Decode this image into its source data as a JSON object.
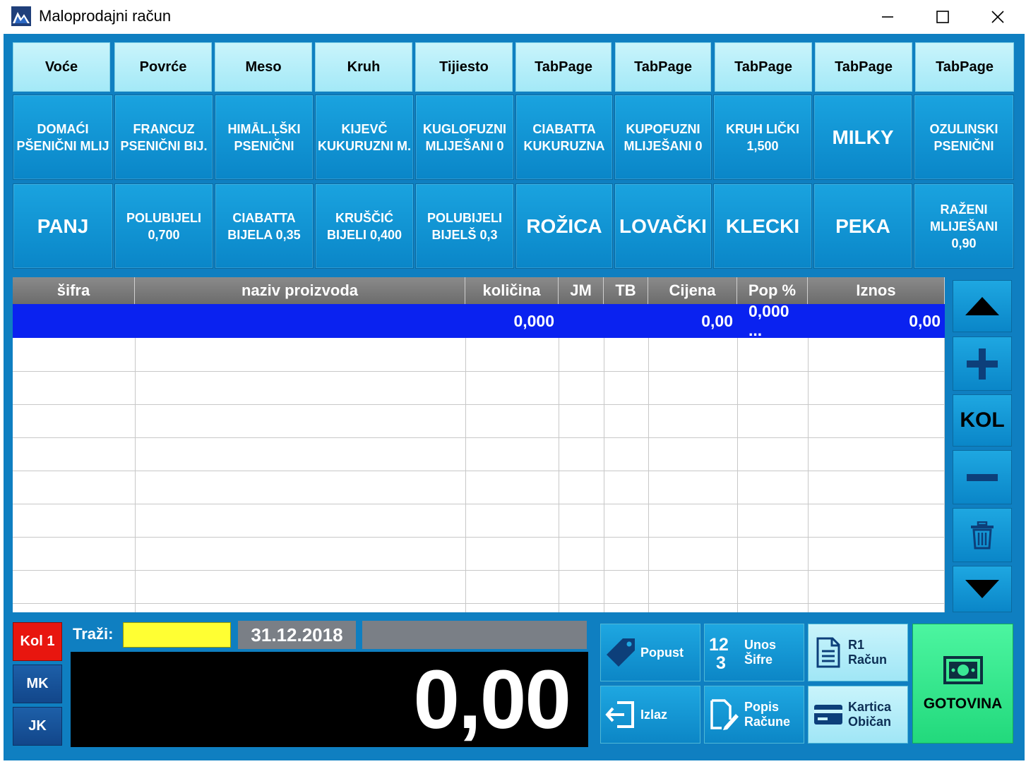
{
  "window": {
    "title": "Maloprodajni račun"
  },
  "colors": {
    "accent": "#0f7fc1",
    "selected_row": "#0a22f0",
    "kol_active": "#e8160f",
    "cash_green": "#22d97c",
    "search_bg": "#ffff33"
  },
  "tabs": [
    "Voće",
    "Povrće",
    "Meso",
    "Kruh",
    "Tijiesto",
    "TabPage",
    "TabPage",
    "TabPage",
    "TabPage",
    "TabPage"
  ],
  "products": [
    [
      "DOMAĆI\nPŠENIČNI MLIJ",
      "FRANCUZ\nPSENIČNI BIJ.",
      "HIMĀL.ĻŠKI\nPSENIČNI",
      "KIJEVČ\nKUKURUZNI M.",
      "KUGLOFUZNI\nMLIJEŠANI 0",
      "CIABATTA\nKUKURUZNA",
      "KUPOFUZNI\nMLIJEŠANI 0",
      "KRUH LIČKI\n1,500",
      "MILKY",
      "OZULINSKI\nPSENIČNI"
    ],
    [
      "PANJ",
      "POLUBIJELI\n0,700",
      "CIABATTA\nBIJELA 0,35",
      "KRUŠČIĆ\nBIJELI 0,400",
      "POLUBIJELI\nBIJELŠ 0,3",
      "ROŽICA",
      "LOVAČKI",
      "KLECKI",
      "PEKA",
      "RAŽENI\nMLIJEŠANI 0,90"
    ]
  ],
  "grid": {
    "columns": [
      "šifra",
      "naziv proizvoda",
      "količina",
      "JM",
      "TB",
      "Cijena",
      "Pop %",
      "Iznos"
    ],
    "selected_row": {
      "sifra": "",
      "naziv": "",
      "kolicina": "0,000",
      "jm": "",
      "tb": "",
      "cijena": "0,00",
      "pop": "0,000 ...",
      "iznos": "0,00"
    }
  },
  "side": {
    "kol_label": "KOL"
  },
  "bottom": {
    "kol1": "Kol 1",
    "mk": "MK",
    "jk": "JK",
    "trazi_label": "Traži:",
    "trazi_value": "",
    "date": "31.12.2018",
    "total": "0,00"
  },
  "actions": {
    "popust": "Popust",
    "unos_sifre": "Unos\nŠifre",
    "r1_racun": "R1\nRačun",
    "izlaz": "Izlaz",
    "popis_racune": "Popis\nRačune",
    "kartica_obican": "Kartica\nObičan",
    "gotovina": "GOTOVINA"
  }
}
